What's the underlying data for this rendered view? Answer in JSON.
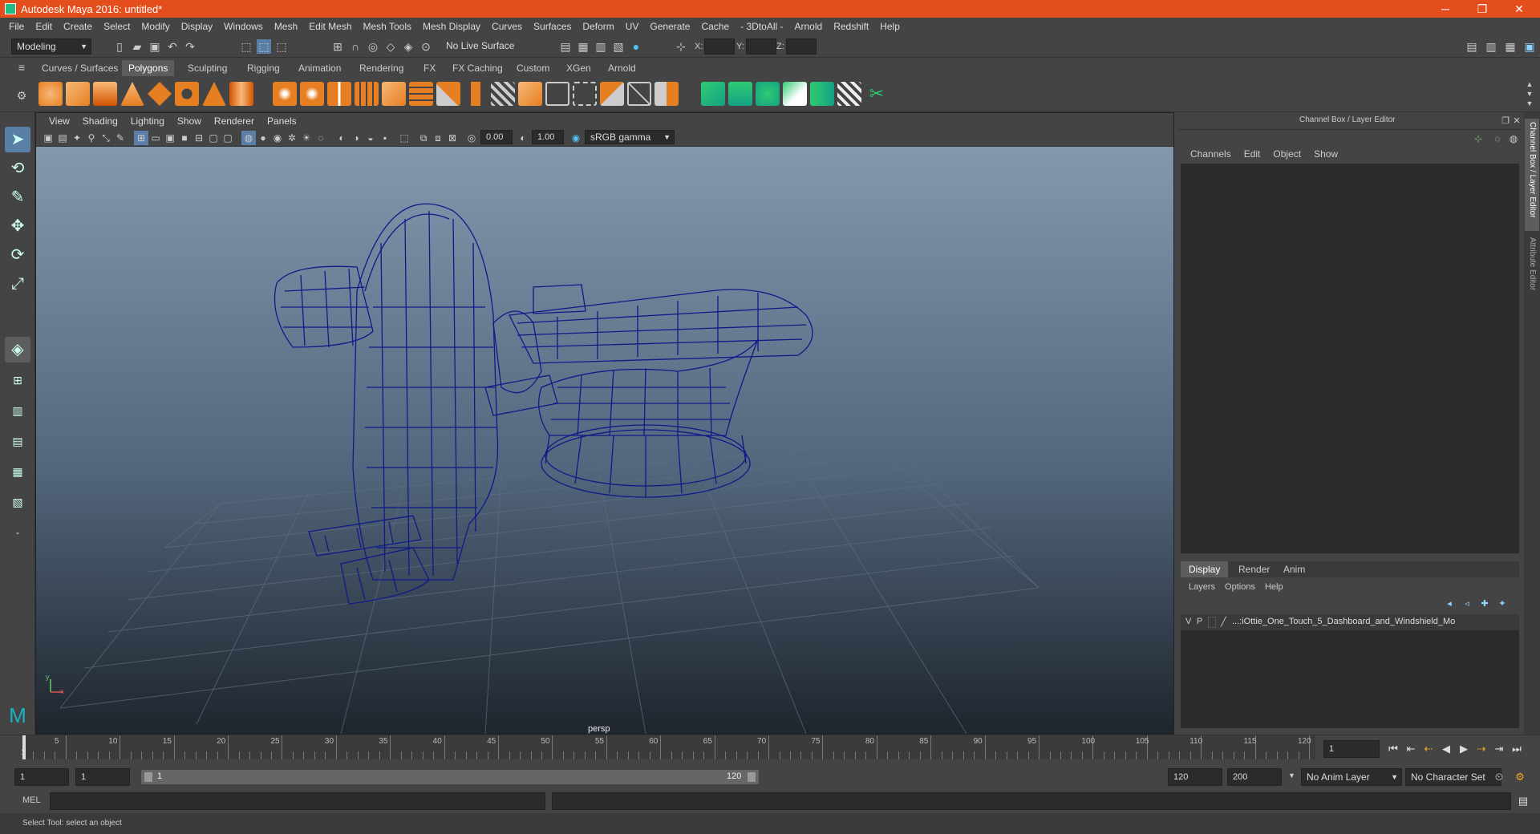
{
  "window": {
    "title": "Autodesk Maya 2016: untitled*",
    "minimize": "─",
    "maximize": "❐",
    "close": "✕"
  },
  "menubar": [
    "File",
    "Edit",
    "Create",
    "Select",
    "Modify",
    "Display",
    "Windows",
    "Mesh",
    "Edit Mesh",
    "Mesh Tools",
    "Mesh Display",
    "Curves",
    "Surfaces",
    "Deform",
    "UV",
    "Generate",
    "Cache",
    "- 3DtoAll -",
    "Arnold",
    "Redshift",
    "Help"
  ],
  "statusline": {
    "mode": "Modeling",
    "live_surface": "No Live Surface",
    "x_label": "X:",
    "y_label": "Y:",
    "z_label": "Z:"
  },
  "shelf_tabs": [
    "Curves / Surfaces",
    "Polygons",
    "Sculpting",
    "Rigging",
    "Animation",
    "Rendering",
    "FX",
    "FX Caching",
    "Custom",
    "XGen",
    "Arnold"
  ],
  "active_shelf_tab": "Polygons",
  "viewport": {
    "menu": [
      "View",
      "Shading",
      "Lighting",
      "Show",
      "Renderer",
      "Panels"
    ],
    "exposure": "0.00",
    "gamma": "1.00",
    "color_space": "sRGB gamma",
    "camera_label": "persp",
    "axis_y": "y",
    "axis_x": "x",
    "wire_color": "#0f1a8a"
  },
  "channel_box": {
    "title": "Channel Box / Layer Editor",
    "menu": [
      "Channels",
      "Edit",
      "Object",
      "Show"
    ],
    "layer_tabs": [
      "Display",
      "Render",
      "Anim"
    ],
    "active_layer_tab": "Display",
    "layer_menu": [
      "Layers",
      "Options",
      "Help"
    ],
    "layer_row": {
      "v": "V",
      "p": "P",
      "name": "...:iOttie_One_Touch_5_Dashboard_and_Windshield_Mo"
    }
  },
  "side_tabs": {
    "channel": "Channel Box / Layer Editor",
    "attribute": "Attribute Editor"
  },
  "timeline": {
    "ticks": [
      "5",
      "10",
      "15",
      "20",
      "25",
      "30",
      "35",
      "40",
      "45",
      "50",
      "55",
      "60",
      "65",
      "70",
      "75",
      "80",
      "85",
      "90",
      "95",
      "100",
      "105",
      "110",
      "115",
      "120"
    ],
    "start_tick": "1",
    "current_frame": "1"
  },
  "range": {
    "start": "1",
    "playback_start": "1",
    "slider_start": "1",
    "slider_end": "120",
    "playback_end": "120",
    "end": "200",
    "anim_layer": "No Anim Layer",
    "character_set": "No Character Set"
  },
  "mel": {
    "label": "MEL"
  },
  "help": {
    "text": "Select Tool: select an object"
  }
}
